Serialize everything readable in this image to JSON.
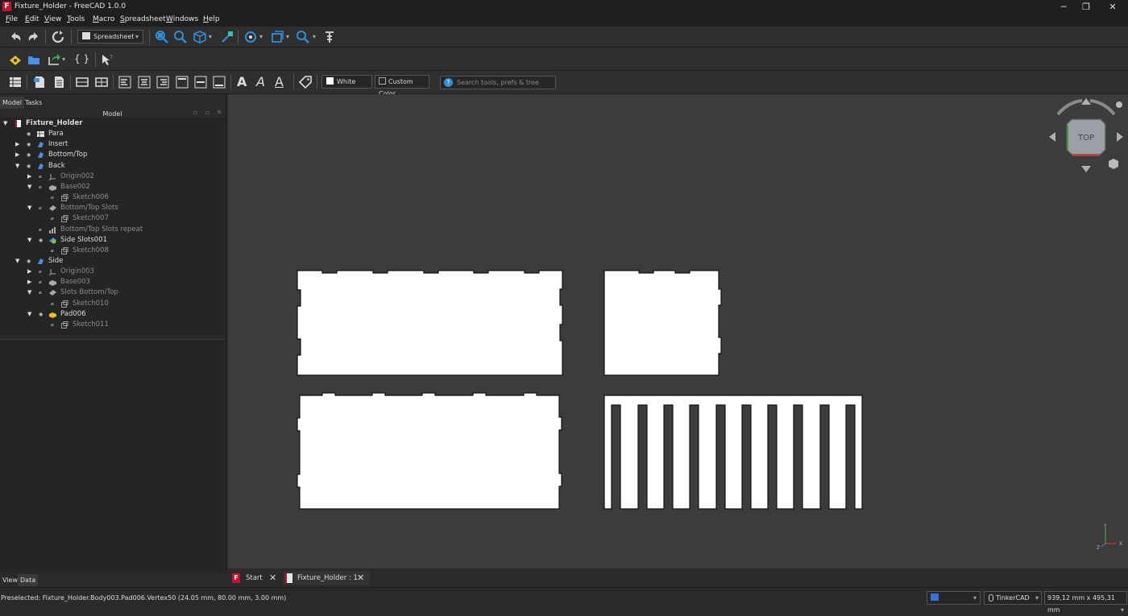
{
  "window": {
    "title": "Fixture_Holder - FreeCAD 1.0.0",
    "app_icon": "F",
    "minimize_glyph": "─",
    "restore_glyph": "❐",
    "close_glyph": "✕"
  },
  "menu": [
    "File",
    "Edit",
    "View",
    "Tools",
    "Macro",
    "Spreadsheet",
    "Windows",
    "Help"
  ],
  "toolbar": {
    "workbench": "Spreadsheet",
    "white_label": "White",
    "custom_color_label": "Custom Color",
    "search_placeholder": "Search tools, prefs & tree",
    "braces": "{ }",
    "font_a1": "A",
    "font_a2": "A",
    "font_a3": "A"
  },
  "left_tabs": {
    "model": "Model",
    "tasks": "Tasks"
  },
  "panel_title": "Model",
  "tree": [
    {
      "label": "Fixture_Holder",
      "bold": true,
      "level": 0,
      "arrow": "▼",
      "eye": false,
      "icon": "document-icon",
      "color": "#ffffff"
    },
    {
      "label": "Para",
      "level": 1,
      "arrow": "",
      "eye": true,
      "icon": "spreadsheet-icon",
      "color": "#e6e6e6"
    },
    {
      "label": "Insert",
      "level": 1,
      "arrow": "▶",
      "eye": true,
      "icon": "body-icon",
      "color": "#4a8fe6"
    },
    {
      "label": "Bottom/Top",
      "level": 1,
      "arrow": "▶",
      "eye": true,
      "icon": "body-icon",
      "color": "#4a8fe6"
    },
    {
      "label": "Back",
      "level": 1,
      "arrow": "▼",
      "eye": true,
      "icon": "body-icon",
      "color": "#4a8fe6"
    },
    {
      "label": "Origin002",
      "level": 2,
      "arrow": "▶",
      "eye": true,
      "dim": true,
      "icon": "origin-icon",
      "color": "#aaaaaa"
    },
    {
      "label": "Base002",
      "level": 2,
      "arrow": "▼",
      "eye": true,
      "dim": true,
      "icon": "pad-icon",
      "color": "#aaaaaa"
    },
    {
      "label": "Sketch006",
      "level": 3,
      "arrow": "",
      "eye": true,
      "dim": true,
      "icon": "sketch-icon",
      "color": "#aaaaaa"
    },
    {
      "label": "Bottom/Top Slots",
      "level": 2,
      "arrow": "▼",
      "eye": true,
      "dim": true,
      "icon": "pocket-icon",
      "color": "#aaaaaa"
    },
    {
      "label": "Sketch007",
      "level": 3,
      "arrow": "",
      "eye": true,
      "dim": true,
      "icon": "sketch-icon",
      "color": "#aaaaaa"
    },
    {
      "label": "Bottom/Top Slots repeat",
      "level": 2,
      "arrow": "",
      "eye": true,
      "dim": true,
      "icon": "pattern-icon",
      "color": "#aaaaaa"
    },
    {
      "label": "Side Slots001",
      "level": 2,
      "arrow": "▼",
      "eye": true,
      "icon": "pocket-tip-icon",
      "color": "#7fc24a"
    },
    {
      "label": "Sketch008",
      "level": 3,
      "arrow": "",
      "eye": true,
      "dim": true,
      "icon": "sketch-icon",
      "color": "#aaaaaa"
    },
    {
      "label": "Side",
      "level": 1,
      "arrow": "▼",
      "eye": true,
      "icon": "body-icon",
      "color": "#4a8fe6"
    },
    {
      "label": "Origin003",
      "level": 2,
      "arrow": "▶",
      "eye": true,
      "dim": true,
      "icon": "origin-icon",
      "color": "#aaaaaa"
    },
    {
      "label": "Base003",
      "level": 2,
      "arrow": "▶",
      "eye": true,
      "dim": true,
      "icon": "pad-icon",
      "color": "#aaaaaa"
    },
    {
      "label": "Slots Bottom/Top",
      "level": 2,
      "arrow": "▼",
      "eye": true,
      "dim": true,
      "icon": "pocket-icon",
      "color": "#aaaaaa"
    },
    {
      "label": "Sketch010",
      "level": 3,
      "arrow": "",
      "eye": true,
      "dim": true,
      "icon": "sketch-icon",
      "color": "#aaaaaa"
    },
    {
      "label": "Pad006",
      "level": 2,
      "arrow": "▼",
      "eye": true,
      "icon": "pad-tip-icon",
      "color": "#e3c21a"
    },
    {
      "label": "Sketch011",
      "level": 3,
      "arrow": "",
      "eye": true,
      "dim": true,
      "icon": "sketch-icon",
      "color": "#aaaaaa"
    }
  ],
  "bottom_tabs": {
    "view": "View",
    "data": "Data"
  },
  "navcube": {
    "face": "TOP"
  },
  "axis": {
    "x": "X",
    "y": "Y",
    "z": "Z"
  },
  "doc_tabs": {
    "start": "Start",
    "document": "Fixture_Holder : 1"
  },
  "status": {
    "preselected": "Preselected: Fixture_Holder.Body003.Pad006.Vertex50 (24.05 mm, 80.00 mm, 3.00 mm)",
    "nav_style": "TinkerCAD",
    "dimensions": "939,12 mm x 495,31 mm"
  },
  "colors": {
    "accent": "#4a8fe6",
    "background": "#3c3c3c",
    "part": "#ffffff",
    "tip": "#e3c21a"
  }
}
